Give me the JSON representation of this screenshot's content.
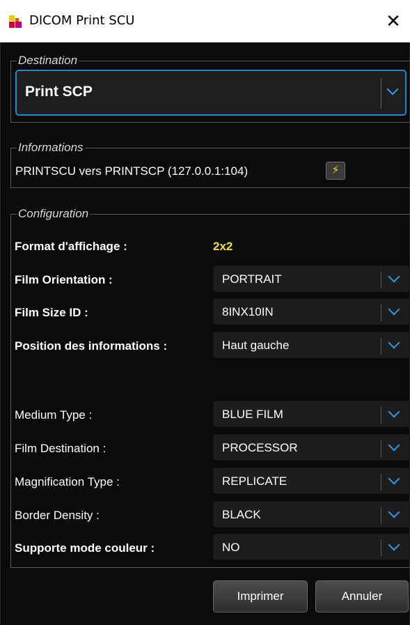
{
  "window": {
    "title": "DICOM Print SCU",
    "close_glyph": "✕",
    "icon_colors": [
      "#f7c600",
      "#e2001a",
      "#e85a00",
      "#c10082"
    ]
  },
  "destination": {
    "legend": "Destination",
    "selected": "Print SCP"
  },
  "informations": {
    "legend": "Informations",
    "text": "PRINTSCU vers PRINTSCP (127.0.0.1:104)",
    "action_icon": "lightning-icon"
  },
  "configuration": {
    "legend": "Configuration",
    "format": {
      "label": "Format d'affichage :",
      "value": "2x2",
      "value_color": "#f2e22a"
    },
    "rows": [
      {
        "label": "Film Orientation :",
        "value": "PORTRAIT"
      },
      {
        "label": "Film Size ID :",
        "value": "8INX10IN"
      },
      {
        "label": "Position des informations :",
        "value": "Haut gauche"
      },
      {
        "label": "Medium Type :",
        "value": "BLUE FILM"
      },
      {
        "label": "Film Destination :",
        "value": "PROCESSOR"
      },
      {
        "label": "Magnification Type :",
        "value": "REPLICATE"
      },
      {
        "label": "Border Density :",
        "value": "BLACK"
      },
      {
        "label": "Supporte mode couleur :",
        "value": "NO"
      }
    ]
  },
  "buttons": {
    "print": "Imprimer",
    "cancel": "Annuler"
  },
  "colors": {
    "accent": "#1a8ad4",
    "chevron": "#2f9be6",
    "background": "#0b0b0b"
  }
}
